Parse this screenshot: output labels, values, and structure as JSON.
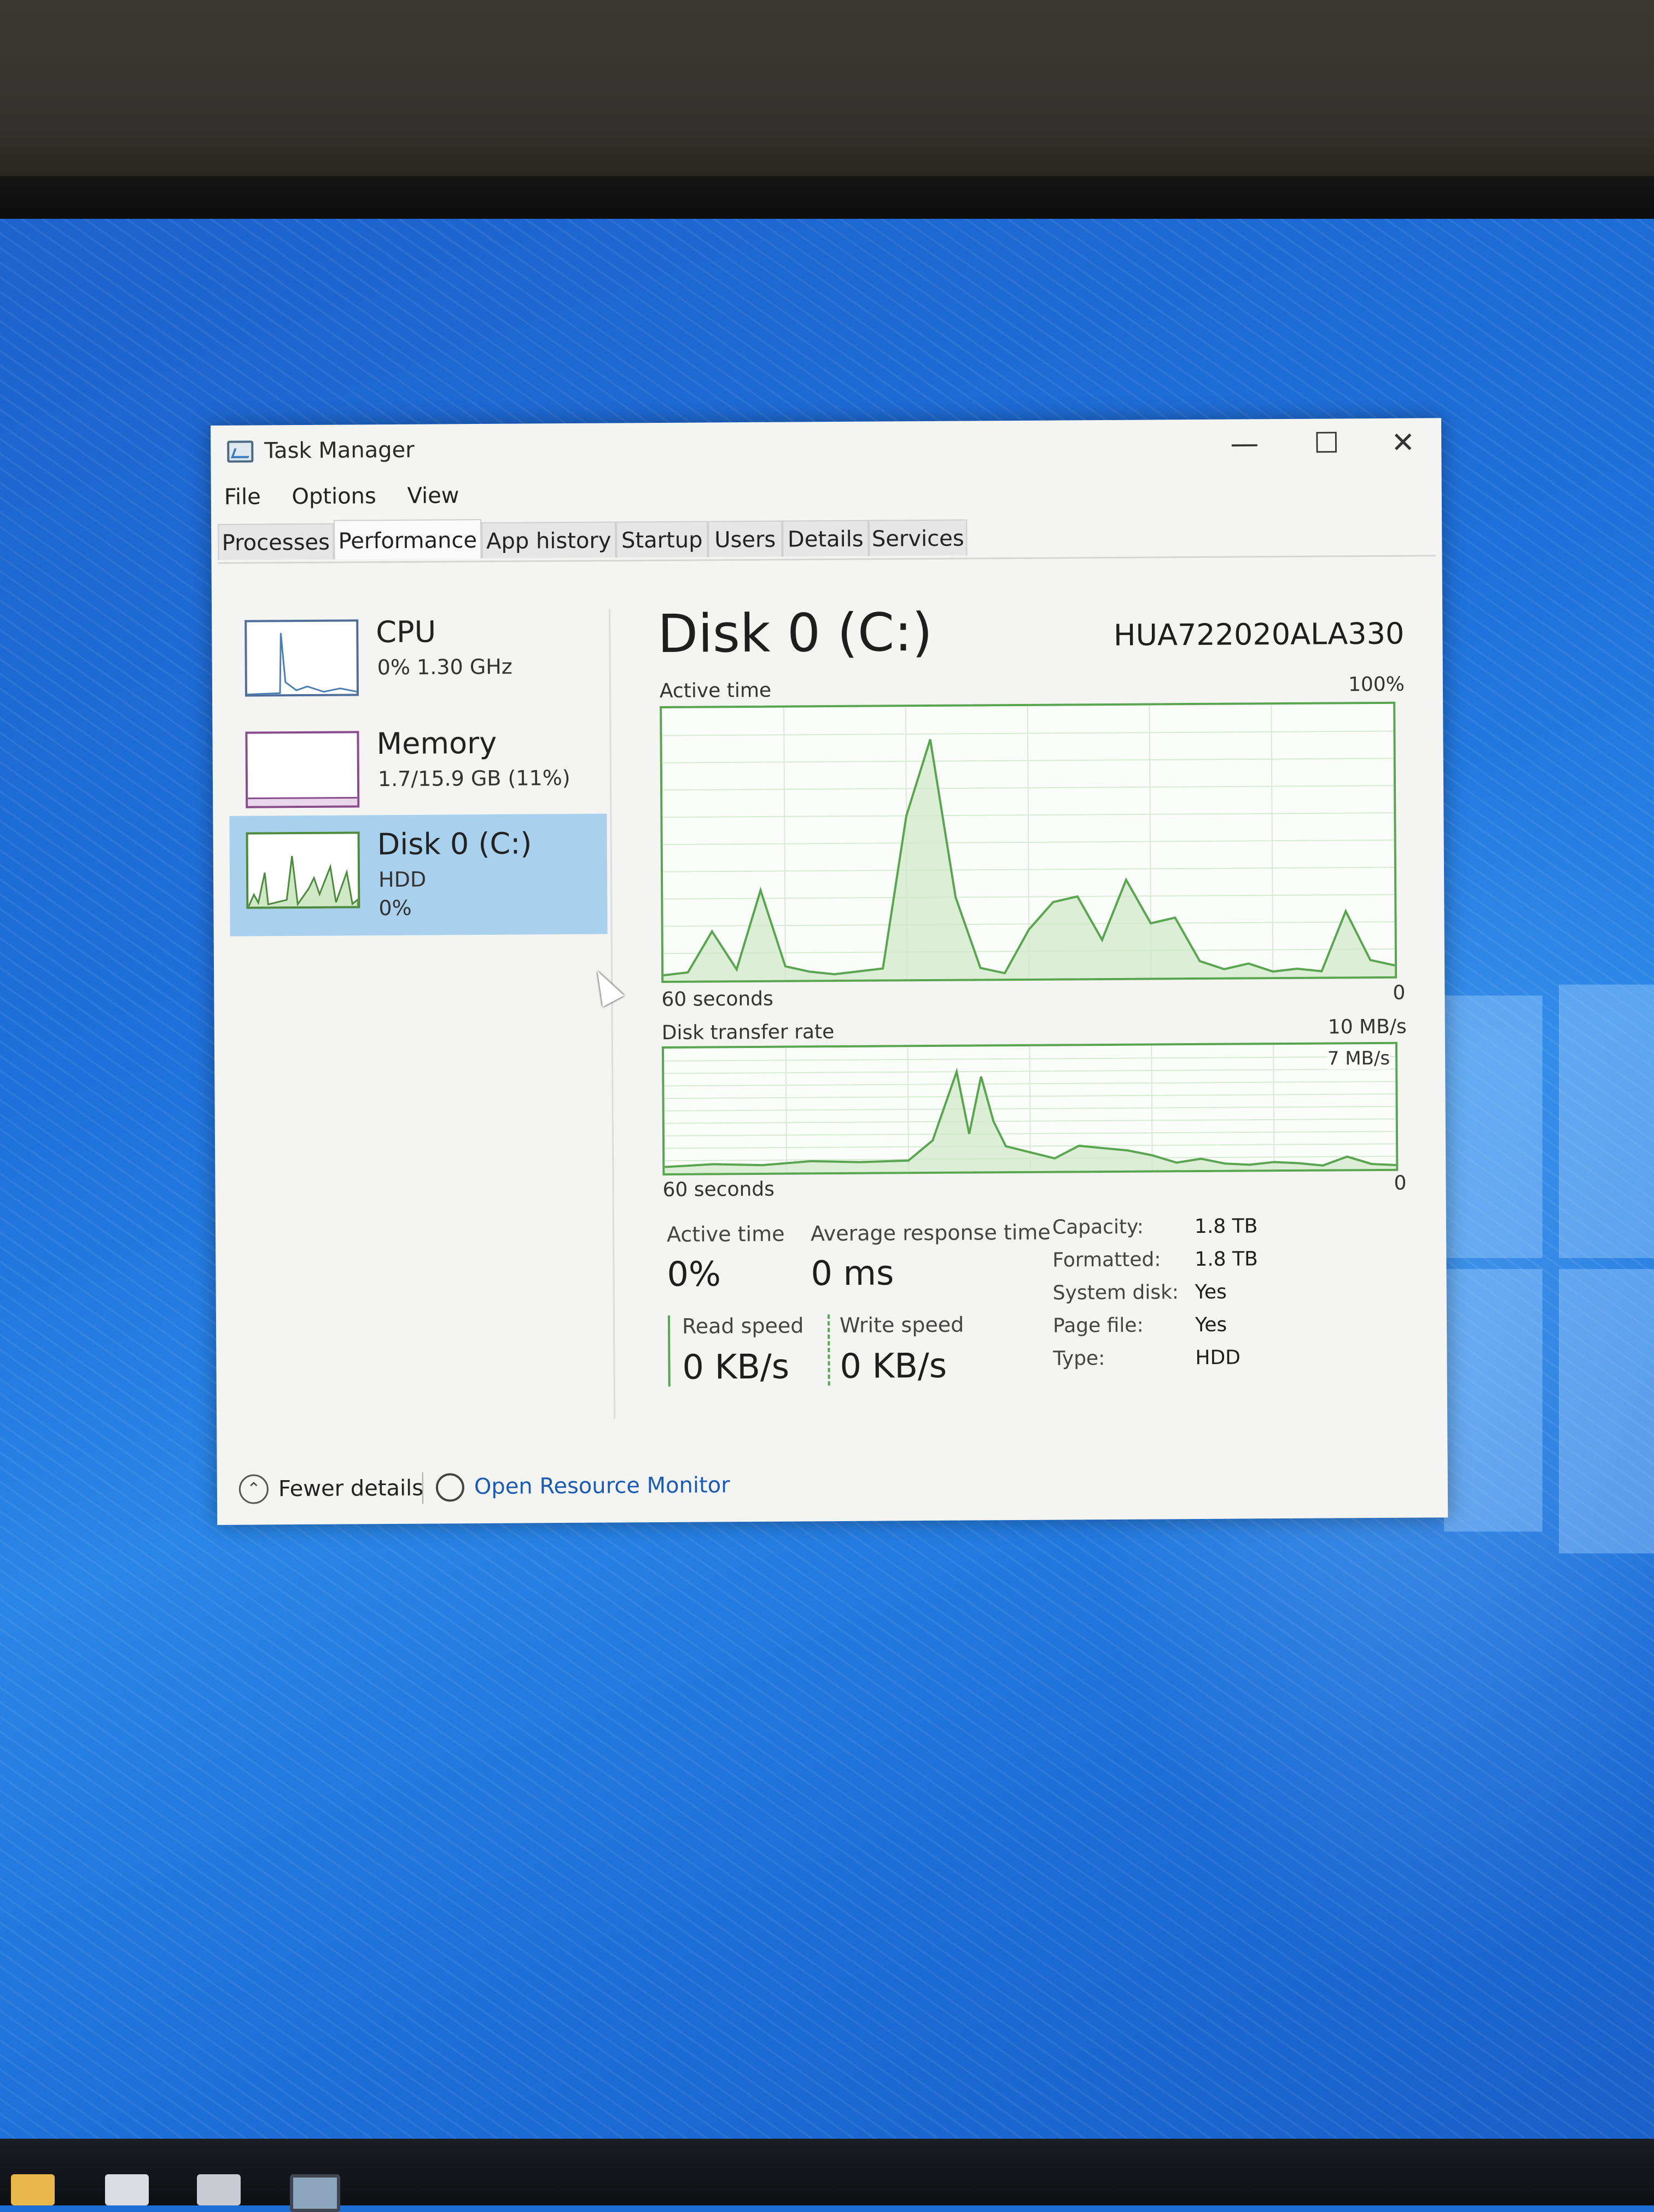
{
  "window": {
    "title": "Task Manager",
    "controls": {
      "minimize": "—",
      "maximize": "☐",
      "close": "✕"
    }
  },
  "menu": [
    "File",
    "Options",
    "View"
  ],
  "tabs": [
    "Processes",
    "Performance",
    "App history",
    "Startup",
    "Users",
    "Details",
    "Services"
  ],
  "active_tab": "Performance",
  "sidebar": {
    "items": [
      {
        "name": "CPU",
        "line1": "0% 1.30 GHz",
        "line2": ""
      },
      {
        "name": "Memory",
        "line1": "1.7/15.9 GB (11%)",
        "line2": ""
      },
      {
        "name": "Disk 0 (C:)",
        "line1": "HDD",
        "line2": "0%"
      }
    ],
    "selected": "Disk 0 (C:)"
  },
  "disk": {
    "title": "Disk 0 (C:)",
    "model": "HUA722020ALA330",
    "active_graph": {
      "label": "Active time",
      "max_label": "100%",
      "time_label": "60 seconds",
      "min_label": "0"
    },
    "transfer_graph": {
      "label": "Disk transfer rate",
      "max_label": "10 MB/s",
      "inner_label": "7 MB/s",
      "time_label": "60 seconds",
      "min_label": "0"
    },
    "stats": {
      "active_time_label": "Active time",
      "active_time_value": "0%",
      "avg_resp_label": "Average response time",
      "avg_resp_value": "0 ms",
      "read_label": "Read speed",
      "read_value": "0 KB/s",
      "write_label": "Write speed",
      "write_value": "0 KB/s"
    },
    "properties": [
      {
        "key": "Capacity:",
        "value": "1.8 TB"
      },
      {
        "key": "Formatted:",
        "value": "1.8 TB"
      },
      {
        "key": "System disk:",
        "value": "Yes"
      },
      {
        "key": "Page file:",
        "value": "Yes"
      },
      {
        "key": "Type:",
        "value": "HDD"
      }
    ]
  },
  "footer": {
    "fewer_details": "Fewer details",
    "resource_monitor": "Open Resource Monitor"
  },
  "colors": {
    "graph_line": "#5aa550",
    "graph_fill": "#cfe8c6",
    "selected_bg": "#a9d1ee",
    "link": "#1a5bb4"
  },
  "chart_data": [
    {
      "type": "area",
      "ylabel": "Active time",
      "ylim": [
        0,
        100
      ],
      "x": [
        60,
        58,
        56,
        54,
        52,
        50,
        48,
        46,
        44,
        42,
        40,
        38,
        36,
        34,
        32,
        30,
        28,
        26,
        24,
        22,
        20,
        18,
        16,
        14,
        12,
        10,
        8,
        6,
        4,
        2,
        0
      ],
      "values": [
        2,
        3,
        18,
        4,
        33,
        5,
        3,
        2,
        3,
        4,
        60,
        88,
        30,
        4,
        2,
        18,
        28,
        30,
        14,
        36,
        20,
        22,
        6,
        3,
        5,
        2,
        3,
        2,
        24,
        6,
        4
      ]
    },
    {
      "type": "line",
      "ylabel": "Disk transfer rate",
      "ylim": [
        0,
        10
      ],
      "x": [
        60,
        56,
        52,
        48,
        44,
        40,
        38,
        36,
        35,
        34,
        33,
        32,
        30,
        28,
        26,
        24,
        22,
        20,
        18,
        16,
        14,
        12,
        10,
        8,
        6,
        4,
        2,
        0
      ],
      "values": [
        0.5,
        0.7,
        0.6,
        0.9,
        0.8,
        0.9,
        2.5,
        8.0,
        3.0,
        7.6,
        4.0,
        2.0,
        1.5,
        1.0,
        2.0,
        1.8,
        1.6,
        1.2,
        0.6,
        0.9,
        0.5,
        0.4,
        0.6,
        0.5,
        0.3,
        1.0,
        0.4,
        0.3
      ]
    }
  ]
}
